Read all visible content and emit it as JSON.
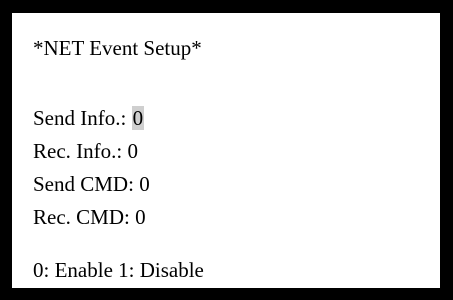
{
  "screen": {
    "title": "*NET Event Setup*",
    "settings": [
      {
        "label": "Send Info.:",
        "value": "0",
        "selected": true
      },
      {
        "label": "Rec. Info.:",
        "value": "0",
        "selected": false
      },
      {
        "label": "Send CMD:",
        "value": "0",
        "selected": false
      },
      {
        "label": "Rec. CMD:",
        "value": "0",
        "selected": false
      }
    ],
    "legend": "0: Enable 1: Disable"
  },
  "colors": {
    "frame": "#000000",
    "background": "#ffffff",
    "cursor_highlight": "#cfcfcf"
  }
}
